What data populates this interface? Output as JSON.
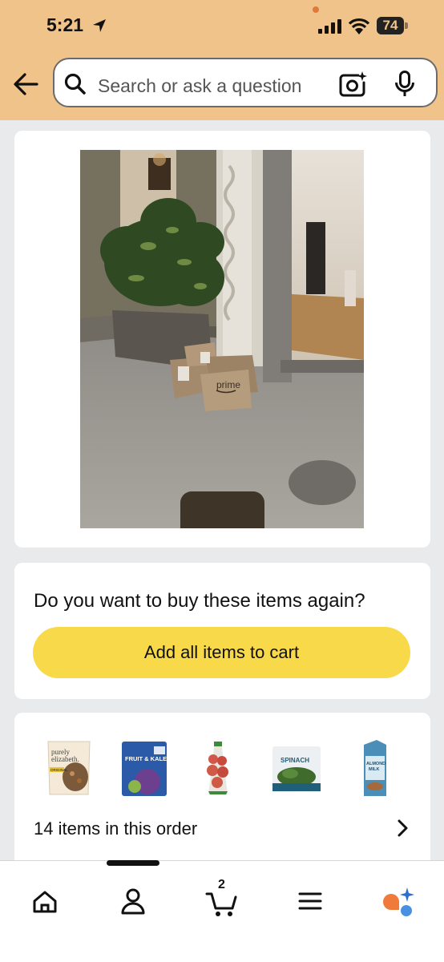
{
  "status_bar": {
    "time": "5:21",
    "battery": "74",
    "icons": [
      "location-arrow-icon",
      "cellular-signal-icon",
      "wifi-icon",
      "battery-icon"
    ]
  },
  "header": {
    "search_placeholder": "Search or ask a question",
    "icons": [
      "back-arrow-icon",
      "search-icon",
      "camera-scan-icon",
      "microphone-icon"
    ]
  },
  "delivery_photo": {
    "bag_label": "prime"
  },
  "buy_again": {
    "question": "Do you want to buy these items again?",
    "button_label": "Add all items to cart"
  },
  "order": {
    "items_count_text": "14 items in this order",
    "thumbnails": [
      {
        "name": "purely elizabeth granola",
        "label_1": "purely",
        "label_2": "elizabeth.",
        "label_3": "ORIGINAL"
      },
      {
        "name": "fruit & kale frozen smoothie pack",
        "label_1": "FRUIT & KALE"
      },
      {
        "name": "bag of tomatoes"
      },
      {
        "name": "frozen spinach",
        "label_1": "SPINACH"
      },
      {
        "name": "almond milk carton",
        "label_1": "ALMOND",
        "label_2": "MILK"
      }
    ]
  },
  "bottom_nav": {
    "items": [
      "home",
      "account",
      "cart",
      "menu",
      "rufus-assistant"
    ],
    "cart_count": "2"
  },
  "colors": {
    "header_bg": "#f0c38b",
    "button_yellow": "#f8d94a",
    "page_bg": "#e9eaec"
  }
}
